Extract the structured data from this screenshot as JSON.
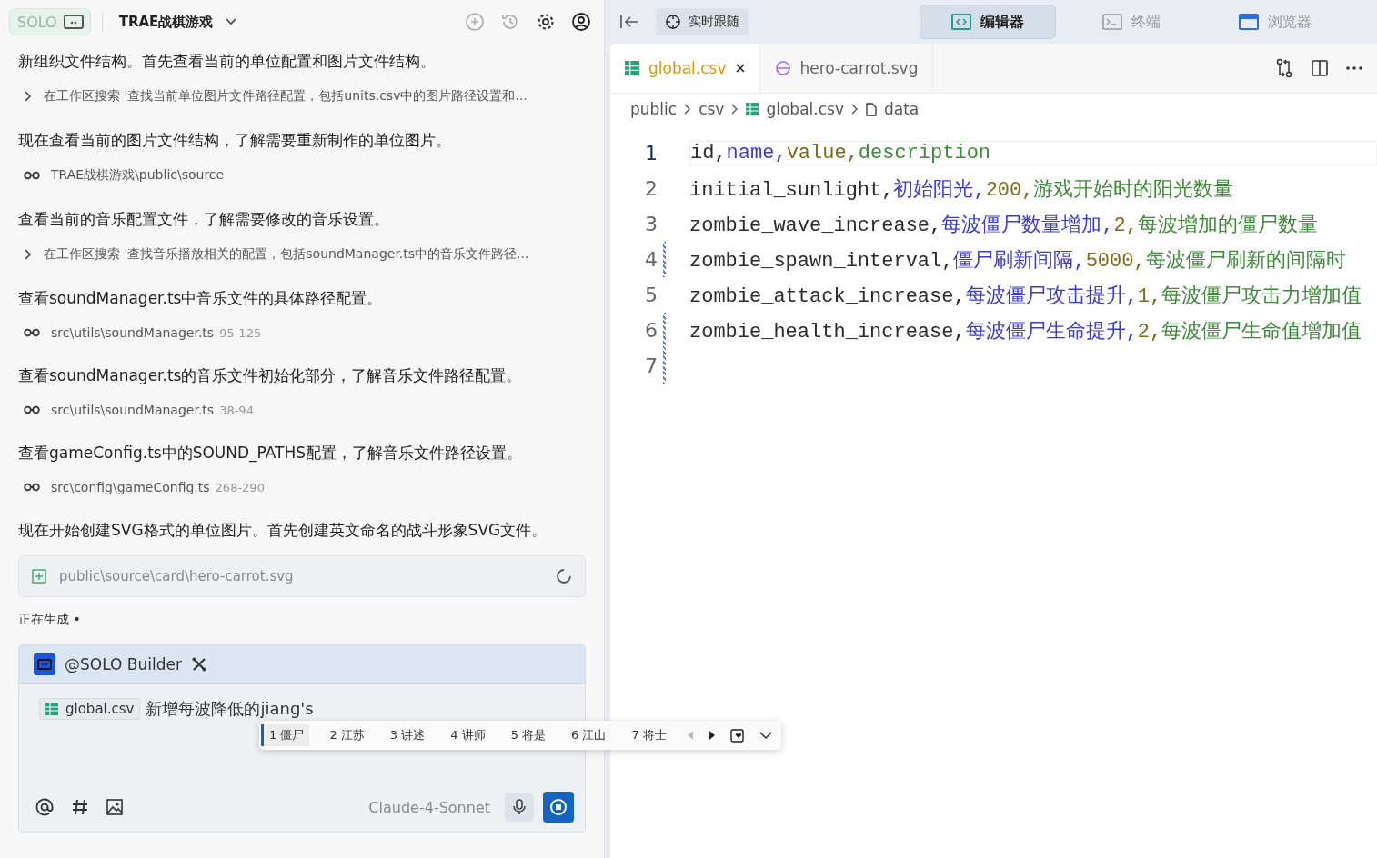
{
  "header": {
    "mode_label": "SOLO",
    "project": "TRAE战棋游戏",
    "solo_active": false
  },
  "messages": [
    {
      "kind": "text",
      "text": "新组织文件结构。首先查看当前的单位配置和图片文件结构。"
    },
    {
      "kind": "search",
      "text": "在工作区搜索 '查找当前单位图片文件路径配置，包括units.csv中的图片路径设置和..."
    },
    {
      "kind": "text",
      "text": "现在查看当前的图片文件结构，了解需要重新制作的单位图片。"
    },
    {
      "kind": "file",
      "text": "TRAE战棋游戏\\public\\source"
    },
    {
      "kind": "text",
      "text": "查看当前的音乐配置文件，了解需要修改的音乐设置。"
    },
    {
      "kind": "search",
      "text": "在工作区搜索 '查找音乐播放相关的配置，包括soundManager.ts中的音乐文件路径..."
    },
    {
      "kind": "text",
      "text": "查看soundManager.ts中音乐文件的具体路径配置。"
    },
    {
      "kind": "file",
      "text": "src\\utils\\soundManager.ts",
      "range": "95-125"
    },
    {
      "kind": "text",
      "text": "查看soundManager.ts的音乐文件初始化部分，了解音乐文件路径配置。"
    },
    {
      "kind": "file",
      "text": "src\\utils\\soundManager.ts",
      "range": "38-94"
    },
    {
      "kind": "text",
      "text": "查看gameConfig.ts中的SOUND_PATHS配置，了解音乐文件路径设置。"
    },
    {
      "kind": "file",
      "text": "src\\config\\gameConfig.ts",
      "range": "268-290"
    },
    {
      "kind": "text",
      "text": "现在开始创建SVG格式的单位图片。首先创建英文命名的战斗形象SVG文件。"
    }
  ],
  "creating_file": {
    "path": "public\\source\\card\\hero-carrot.svg"
  },
  "status": "正在生成 •",
  "composer": {
    "agent": "@SOLO Builder",
    "context_file": "global.csv",
    "value": "新增每波降低的jiang's",
    "model": "Claude-4-Sonnet"
  },
  "ime_candidates": [
    {
      "text": "1 僵尸",
      "selected": true
    },
    {
      "text": "2 江苏",
      "selected": false
    },
    {
      "text": "3 讲述",
      "selected": false
    },
    {
      "text": "4 讲师",
      "selected": false
    },
    {
      "text": "5 将是",
      "selected": false
    },
    {
      "text": "6 江山",
      "selected": false
    },
    {
      "text": "7 将士",
      "selected": false
    }
  ],
  "follow_button": "实时跟随",
  "view_tabs": [
    {
      "kind": "editor",
      "label": "编辑器",
      "selected": true
    },
    {
      "kind": "terminal",
      "label": "终端",
      "selected": false
    },
    {
      "kind": "browser",
      "label": "浏览器",
      "selected": false
    }
  ],
  "file_tabs": [
    {
      "kind": "csv",
      "label": "global.csv",
      "selected": true
    },
    {
      "kind": "svg",
      "label": "hero-carrot.svg",
      "selected": false
    }
  ],
  "breadcrumb": [
    {
      "kind": "folder",
      "label": "public"
    },
    {
      "kind": "folder",
      "label": "csv"
    },
    {
      "kind": "csv",
      "label": "global.csv"
    },
    {
      "kind": "file",
      "label": "data"
    }
  ],
  "code_lines": [
    {
      "number": "1",
      "modified": false,
      "cells": [
        "id,",
        "name,",
        "value,",
        "description"
      ]
    },
    {
      "number": "2",
      "modified": false,
      "cells": [
        "initial_sunlight,",
        "初始阳光,",
        "200,",
        "游戏开始时的阳光数量"
      ]
    },
    {
      "number": "3",
      "modified": false,
      "cells": [
        "zombie_wave_increase,",
        "每波僵尸数量增加,",
        "2,",
        "每波增加的僵尸数量"
      ]
    },
    {
      "number": "4",
      "modified": true,
      "cells": [
        "zombie_spawn_interval,",
        "僵尸刷新间隔,",
        "5000,",
        "每波僵尸刷新的间隔时"
      ]
    },
    {
      "number": "5",
      "modified": false,
      "cells": [
        "zombie_attack_increase,",
        "每波僵尸攻击提升,",
        "1,",
        "每波僵尸攻击力增加值"
      ]
    },
    {
      "number": "6",
      "modified": true,
      "cells": [
        "zombie_health_increase,",
        "每波僵尸生命提升,",
        "2,",
        "每波僵尸生命值增加值"
      ]
    },
    {
      "number": "7",
      "modified": true
    }
  ]
}
